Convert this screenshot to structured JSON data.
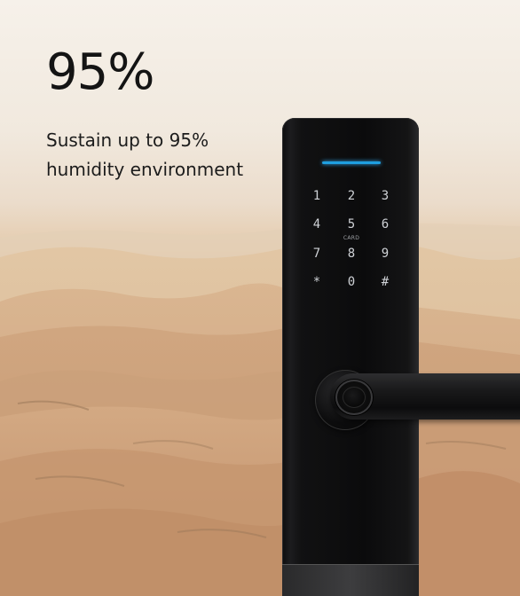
{
  "headline": "95%",
  "subtitle": "Sustain up to 95% humidity environment",
  "keypad": {
    "keys": [
      "1",
      "2",
      "3",
      "4",
      "5",
      "6",
      "7",
      "8",
      "9",
      "*",
      "0",
      "#"
    ],
    "card_label": "CARD"
  },
  "colors": {
    "indicator": "#1f9fe0",
    "text": "#141414",
    "lock_body": "#0d0d0e"
  }
}
